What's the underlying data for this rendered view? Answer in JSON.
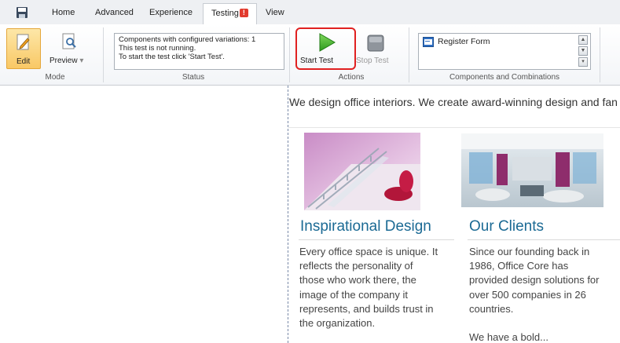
{
  "tabs": {
    "home": "Home",
    "advanced": "Advanced",
    "experience": "Experience",
    "testing": "Testing",
    "testing_badge": "!",
    "view": "View"
  },
  "ribbon": {
    "mode": {
      "group_label": "Mode",
      "edit_label": "Edit",
      "preview_label": "Preview"
    },
    "status": {
      "group_label": "Status",
      "lines": [
        "Components with configured variations: 1",
        "This test is not running.",
        "To start the test click 'Start Test'."
      ]
    },
    "actions": {
      "group_label": "Actions",
      "start_label": "Start Test",
      "stop_label": "Stop Test"
    },
    "components": {
      "group_label": "Components and Combinations",
      "items": [
        "Register Form"
      ]
    }
  },
  "content": {
    "intro": "We design office interiors. We create award-winning design and fan",
    "columns": [
      {
        "heading": "Inspirational Design",
        "lines": [
          "Every office space is unique. It",
          "reflects the personality of",
          "those who work there, the",
          "image of the company it",
          "represents, and builds trust in",
          "the organization."
        ]
      },
      {
        "heading": "Our Clients",
        "lines": [
          "Since our founding back in",
          "1986, Office Core has",
          "provided design solutions for",
          "over 500 companies in 26",
          "countries.",
          "",
          "We have a bold..."
        ]
      }
    ]
  },
  "colors": {
    "accent_heading": "#1b6a94",
    "highlight_border": "#e02020",
    "edit_button": "#f9c865",
    "badge": "#e23b2e"
  },
  "icons": [
    "save-icon",
    "edit-icon",
    "preview-icon",
    "play-icon",
    "stop-icon",
    "form-icon"
  ]
}
